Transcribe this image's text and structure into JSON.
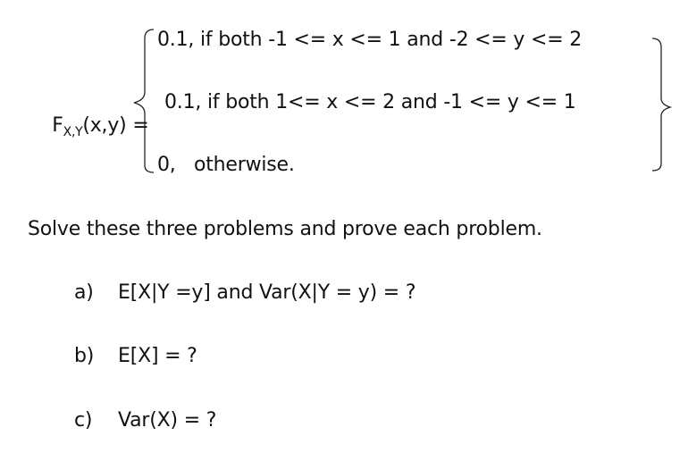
{
  "formula": {
    "lhs_prefix": "F",
    "lhs_subscript": "X,Y",
    "lhs_suffix": "(x,y) =",
    "cases": [
      {
        "text": "0.1, if both -1 <= x <= 1 and -2 <= y <= 2"
      },
      {
        "text": "0.1, if both 1<= x <= 2 and -1 <= y <= 1"
      },
      {
        "text": "0,   otherwise."
      }
    ]
  },
  "instruction": "Solve these three problems and prove each problem.",
  "problems": [
    {
      "label": "a)",
      "text": "E[X|Y =y] and Var(X|Y = y) = ?"
    },
    {
      "label": "b)",
      "text": "E[X] = ?"
    },
    {
      "label": "c)",
      "text": "Var(X) = ?"
    }
  ]
}
